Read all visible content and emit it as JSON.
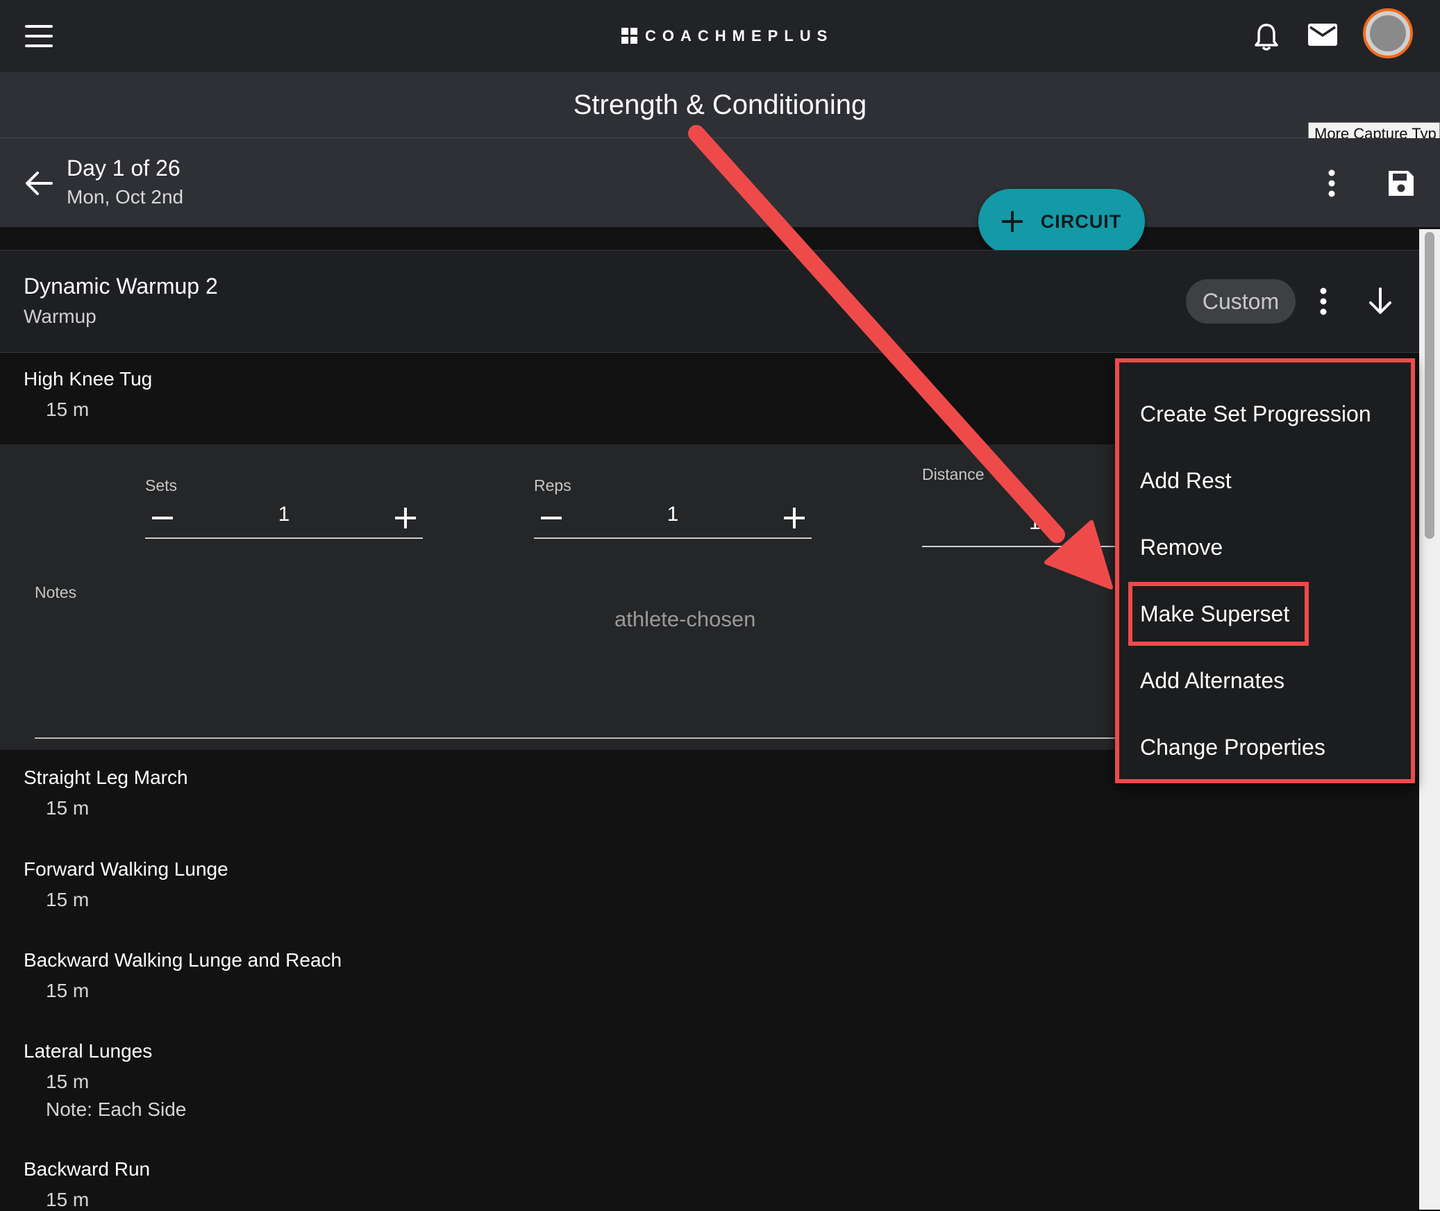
{
  "app": {
    "brand": "COACHMEPLUS"
  },
  "header": {
    "page_title": "Strength & Conditioning",
    "tooltip": "More Capture Typ"
  },
  "day": {
    "title": "Day 1 of 26",
    "date": "Mon, Oct 2nd"
  },
  "circuit_button": {
    "label": "CIRCUIT"
  },
  "block": {
    "title": "Dynamic Warmup 2",
    "subtitle": "Warmup",
    "chip": "Custom"
  },
  "active_exercise": {
    "name": "High Knee Tug",
    "value": "15 m",
    "fields": {
      "sets_label": "Sets",
      "sets_value": "1",
      "reps_label": "Reps",
      "reps_value": "1",
      "distance_label": "Distance",
      "distance_partial": "1"
    },
    "notes_label": "Notes",
    "notes_value": "athlete-chosen"
  },
  "exercises": [
    {
      "name": "Straight Leg March",
      "value": "15 m"
    },
    {
      "name": "Forward Walking Lunge",
      "value": "15 m"
    },
    {
      "name": "Backward Walking Lunge and Reach",
      "value": "15 m"
    },
    {
      "name": "Lateral Lunges",
      "value": "15 m",
      "note": "Note: Each Side"
    },
    {
      "name": "Backward Run",
      "value": "15 m"
    }
  ],
  "menu": {
    "items": [
      "Create Set Progression",
      "Add Rest",
      "Remove",
      "Make Superset",
      "Add Alternates",
      "Change Properties"
    ]
  },
  "colors": {
    "accent": "#139aa6",
    "annotation": "#ef4a4a",
    "avatar_ring": "#f26b1d"
  }
}
